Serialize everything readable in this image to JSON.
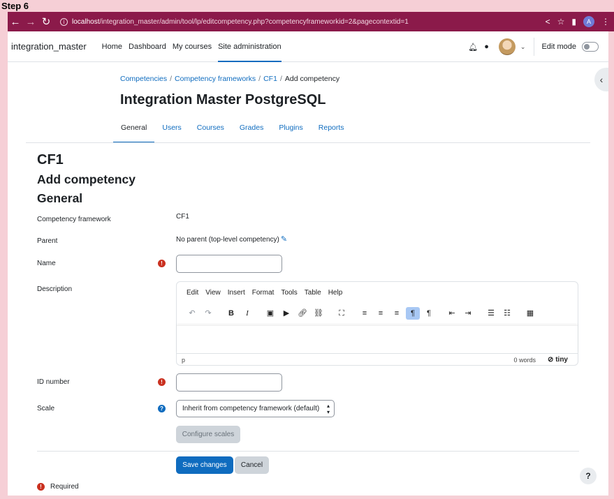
{
  "step_label": "Step 6",
  "browser": {
    "url_host": "localhost",
    "url_path": "/integration_master/admin/tool/lp/editcompetency.php?competencyframeworkid=2&pagecontextid=1",
    "profile_initial": "A"
  },
  "navbar": {
    "site_name": "integration_master",
    "links": [
      "Home",
      "Dashboard",
      "My courses",
      "Site administration"
    ],
    "edit_mode_label": "Edit mode"
  },
  "breadcrumb": [
    "Competencies",
    "Competency frameworks",
    "CF1",
    "Add competency"
  ],
  "page_title": "Integration Master PostgreSQL",
  "tabs": [
    "General",
    "Users",
    "Courses",
    "Grades",
    "Plugins",
    "Reports"
  ],
  "headings": {
    "framework": "CF1",
    "add": "Add competency",
    "section": "General"
  },
  "form": {
    "framework_label": "Competency framework",
    "framework_value": "CF1",
    "parent_label": "Parent",
    "parent_value": "No parent (top-level competency)",
    "name_label": "Name",
    "name_value": "",
    "description_label": "Description",
    "idnumber_label": "ID number",
    "idnumber_value": "",
    "scale_label": "Scale",
    "scale_value": "Inherit from competency framework (default)",
    "configure_scales": "Configure scales",
    "save": "Save changes",
    "cancel": "Cancel",
    "required_legend": "Required"
  },
  "editor": {
    "menus": [
      "Edit",
      "View",
      "Insert",
      "Format",
      "Tools",
      "Table",
      "Help"
    ],
    "status_path": "p",
    "word_count": "0 words",
    "brand": "tiny"
  }
}
